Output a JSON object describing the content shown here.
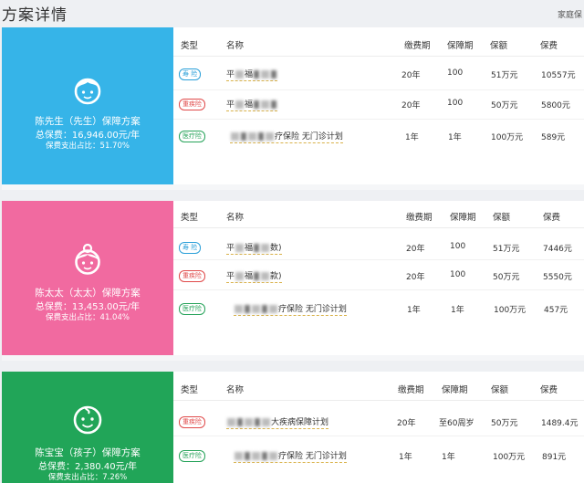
{
  "header": {
    "title": "方案详情",
    "link": "家庭保"
  },
  "columns": {
    "type": "类型",
    "name": "名称",
    "pay_period": "缴费期",
    "term": "保障期",
    "coverage": "保额",
    "premium": "保费"
  },
  "colors": {
    "husband": "#36b4e8",
    "wife": "#f16aa0",
    "child": "#21a558"
  },
  "plans": [
    {
      "icon": "boy-avatar-icon",
      "title": "陈先生（先生）保障方案",
      "total": "总保费：16,946.00元/年",
      "ratio": "保费支出占比：51.70%",
      "rows": [
        {
          "type": "寿 险",
          "name_a": "平",
          "name_b": "福",
          "name_c": "",
          "pay": "20年",
          "term": "100",
          "coverage": "51万元",
          "premium": "10557元"
        },
        {
          "type": "重疾险",
          "name_a": "平",
          "name_b": "福",
          "name_c": "",
          "pay": "20年",
          "term": "100",
          "coverage": "50万元",
          "premium": "5800元"
        },
        {
          "type": "医疗险",
          "name_a": "",
          "name_b": "",
          "name_c": "疗保险 无门诊计划",
          "pay": "1年",
          "term": "1年",
          "coverage": "100万元",
          "premium": "589元"
        }
      ]
    },
    {
      "icon": "woman-avatar-icon",
      "title": "陈太太（太太）保障方案",
      "total": "总保费：13,453.00元/年",
      "ratio": "保费支出占比：41.04%",
      "rows": [
        {
          "type": "寿 险",
          "name_a": "平",
          "name_b": "福",
          "name_c": "数)",
          "pay": "20年",
          "term": "100",
          "coverage": "51万元",
          "premium": "7446元"
        },
        {
          "type": "重疾险",
          "name_a": "平",
          "name_b": "福",
          "name_c": "款)",
          "pay": "20年",
          "term": "100",
          "coverage": "50万元",
          "premium": "5550元"
        },
        {
          "type": "医疗险",
          "name_a": "",
          "name_b": "",
          "name_c": "疗保险 无门诊计划",
          "pay": "1年",
          "term": "1年",
          "coverage": "100万元",
          "premium": "457元"
        }
      ]
    },
    {
      "icon": "baby-avatar-icon",
      "title": "陈宝宝（孩子）保障方案",
      "total": "总保费：2,380.40元/年",
      "ratio": "保费支出占比：7.26%",
      "rows": [
        {
          "type": "重疾险",
          "name_a": "",
          "name_b": "",
          "name_c": "大疾病保障计划",
          "pay": "20年",
          "term": "至60周岁",
          "coverage": "50万元",
          "premium": "1489.4元"
        },
        {
          "type": "医疗险",
          "name_a": "",
          "name_b": "",
          "name_c": "疗保险 无门诊计划",
          "pay": "1年",
          "term": "1年",
          "coverage": "100万元",
          "premium": "891元"
        }
      ]
    }
  ]
}
